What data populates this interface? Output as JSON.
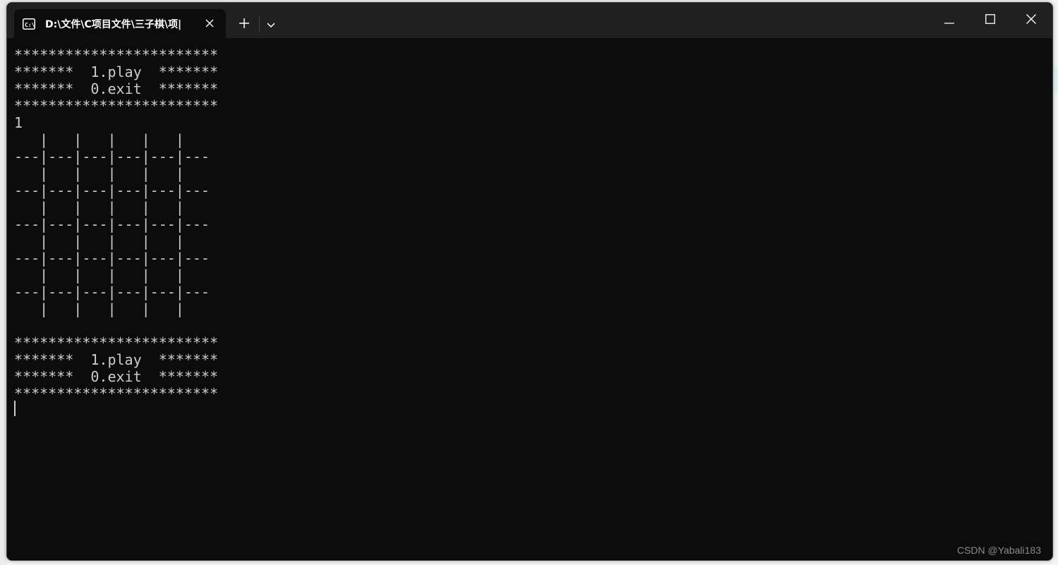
{
  "window": {
    "tab_title": "D:\\文件\\C项目文件\\三子棋\\项|",
    "icon": "terminal-icon"
  },
  "titlebar": {
    "new_tab_icon": "plus-icon",
    "dropdown_icon": "chevron-down-icon",
    "minimize_icon": "minimize-icon",
    "maximize_icon": "maximize-icon",
    "close_icon": "close-icon"
  },
  "terminal": {
    "lines": [
      "************************",
      "*******  1.play  *******",
      "*******  0.exit  *******",
      "************************",
      "1",
      "   |   |   |   |   |",
      "---|---|---|---|---|---",
      "   |   |   |   |   |",
      "---|---|---|---|---|---",
      "   |   |   |   |   |",
      "---|---|---|---|---|---",
      "   |   |   |   |   |",
      "---|---|---|---|---|---",
      "   |   |   |   |   |",
      "---|---|---|---|---|---",
      "   |   |   |   |   |",
      "",
      "************************",
      "*******  1.play  *******",
      "*******  0.exit  *******",
      "************************"
    ]
  },
  "watermark": "CSDN @Yabali183",
  "colors": {
    "terminal_bg": "#0c0c0c",
    "titlebar_bg": "#202020",
    "text": "#cccccc"
  }
}
